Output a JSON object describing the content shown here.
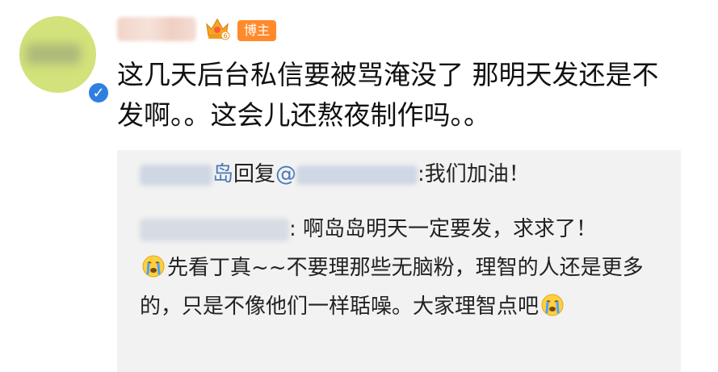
{
  "post": {
    "text": "这几天后台私信要被骂淹没了 那明天发还是不发啊。。这会儿还熬夜制作吗。。",
    "author_tag": "博主"
  },
  "reply": {
    "author_suffix": "岛",
    "reply_word": "回复",
    "at_symbol": "@",
    "reply_text": ":我们加油！",
    "quote_colon": ":",
    "quote_part1": " 啊岛岛明天一定要发，求求了！",
    "quote_part2": "先看丁真~~不要理那些无脑粉，理智的人还是更多的，只是不像他们一样聒噪。大家理智点吧"
  },
  "icons": {
    "verified": "verified-badge-icon",
    "crown": "crown-level-icon",
    "cry": "crying-emoji-icon"
  },
  "colors": {
    "avatar_bg": "#d3e27a",
    "verified_blue": "#2f7fe0",
    "tag_orange": "#ff8a2b",
    "link_blue": "#4a78b8",
    "reply_bg": "#f2f2f2"
  }
}
